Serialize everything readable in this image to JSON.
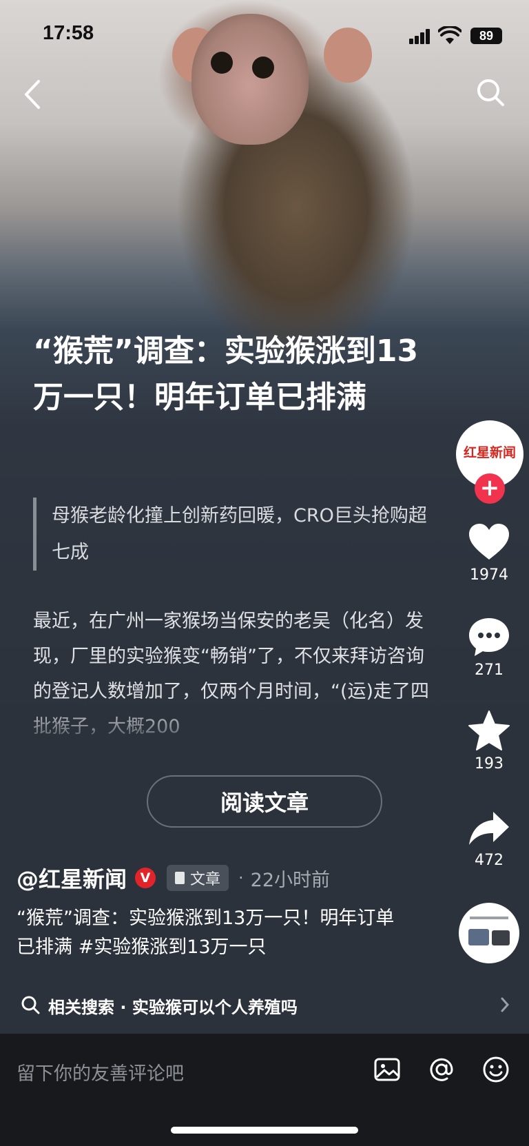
{
  "status_bar": {
    "time": "17:58",
    "battery": "89"
  },
  "article": {
    "title": "“猴荒”调查：实验猴涨到13万一只！明年订单已排满",
    "subtitle": "母猴老龄化撞上创新药回暖，CRO巨头抢购超七成",
    "body": "最近，在广州一家猴场当保安的老吴（化名）发现，厂里的实验猴变“畅销”了，不仅来拜访咨询的登记人数增加了，仅两个月时间，“(运)走了四批猴子，大概200",
    "read_button": "阅读文章"
  },
  "author": {
    "name": "@红星新闻",
    "verified_badge": "V",
    "tag": "文章",
    "time_ago": "22小时前"
  },
  "avatar_logo": "红星新闻",
  "caption": "“猴荒”调查：实验猴涨到13万一只！明年订单已排满 #实验猴涨到13万一只",
  "related_search": "相关搜索 · 实验猴可以个人养殖吗",
  "actions": {
    "follow": "+",
    "likes": "1974",
    "comments": "271",
    "favorites": "193",
    "shares": "472"
  },
  "comment_bar": {
    "placeholder": "留下你的友善评论吧"
  },
  "icons": [
    "back-arrow-icon",
    "search-icon",
    "heart-icon",
    "comment-bubble-icon",
    "star-icon",
    "share-arrow-icon",
    "image-icon",
    "at-icon",
    "emoji-icon",
    "magnifier-icon",
    "chevron-right-icon"
  ],
  "colors": {
    "background": "#2c323b",
    "accent_red": "#f2334d",
    "bottom_bar": "#17191d"
  }
}
